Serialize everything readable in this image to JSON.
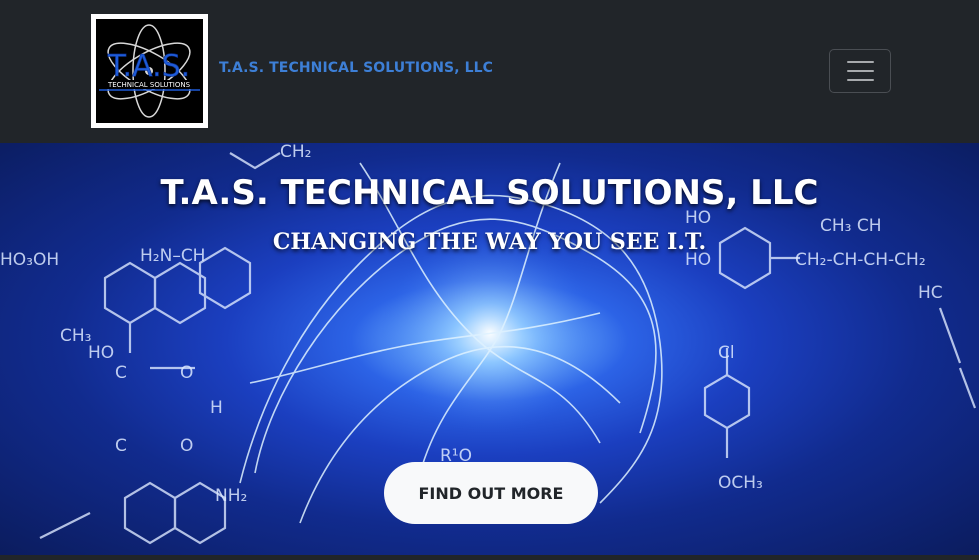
{
  "navbar": {
    "logo": {
      "big_text": "T.A.S.",
      "small_text": "TECHNICAL SOLUTIONS"
    },
    "brand": "T.A.S. TECHNICAL SOLUTIONS, LLC",
    "menu_icon": "hamburger-menu-icon"
  },
  "hero": {
    "title": "T.A.S. TECHNICAL SOLUTIONS, LLC",
    "subtitle": "CHANGING THE WAY YOU SEE I.T.",
    "cta_label": "FIND OUT MORE"
  },
  "colors": {
    "navbar_bg": "#212529",
    "brand_text": "#3d7fd6",
    "hero_blue": "#1b3fc0",
    "button_bg": "#f8f9fa"
  }
}
